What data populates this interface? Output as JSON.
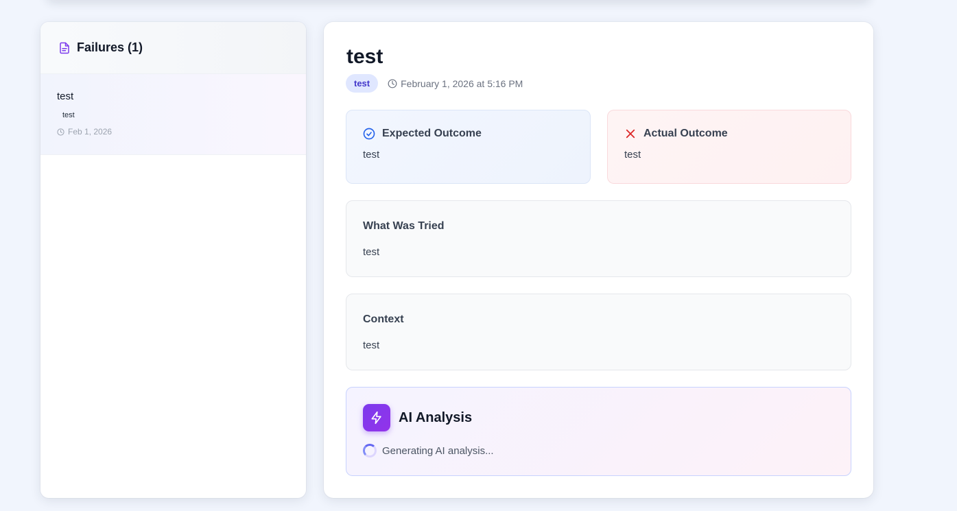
{
  "sidebar": {
    "title": "Failures (1)",
    "items": [
      {
        "title": "test",
        "tag": "test",
        "date": "Feb 1, 2026"
      }
    ]
  },
  "detail": {
    "title": "test",
    "tag": "test",
    "datetime": "February 1, 2026 at 5:16 PM",
    "expected": {
      "label": "Expected Outcome",
      "value": "test"
    },
    "actual": {
      "label": "Actual Outcome",
      "value": "test"
    },
    "tried": {
      "label": "What Was Tried",
      "value": "test"
    },
    "context": {
      "label": "Context",
      "value": "test"
    },
    "ai": {
      "label": "AI Analysis",
      "status": "Generating AI analysis..."
    }
  },
  "icons": {
    "sidebar_header": "document-icon",
    "date": "clock-icon",
    "expected": "check-circle-icon",
    "actual": "x-icon",
    "ai": "lightning-icon",
    "loading": "spinner-icon"
  },
  "colors": {
    "accent": "#7c3aed",
    "tag_bg": "#e0e7ff",
    "tag_text": "#4338ca",
    "expected_icon": "#2563eb",
    "actual_icon": "#dc2626"
  }
}
